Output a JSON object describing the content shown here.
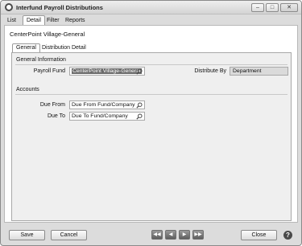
{
  "window": {
    "title": "Interfund Payroll Distributions",
    "controls": {
      "minimize": "–",
      "maximize": "□",
      "close": "✕"
    }
  },
  "menu_tabs": [
    "List",
    "Detail",
    "Filter",
    "Reports"
  ],
  "active_menu_tab": "Detail",
  "company_name": "CenterPoint Village-General",
  "sub_tabs": [
    "General",
    "Distribution Detail"
  ],
  "active_sub_tab": "General",
  "general_info": {
    "heading": "General Information",
    "payroll_fund_label": "Payroll Fund",
    "payroll_fund_value": "CenterPoint Village-General",
    "distribute_by_label": "Distribute By",
    "distribute_by_value": "Department"
  },
  "accounts": {
    "heading": "Accounts",
    "due_from_label": "Due From",
    "due_from_value": "Due From Fund/Company",
    "due_to_label": "Due To",
    "due_to_value": "Due To Fund/Company"
  },
  "footer": {
    "save_label": "Save",
    "cancel_label": "Cancel",
    "close_label": "Close",
    "nav": {
      "first": "◀◀",
      "prev": "◀",
      "next": "▶",
      "last": "▶▶"
    },
    "help": "?"
  }
}
